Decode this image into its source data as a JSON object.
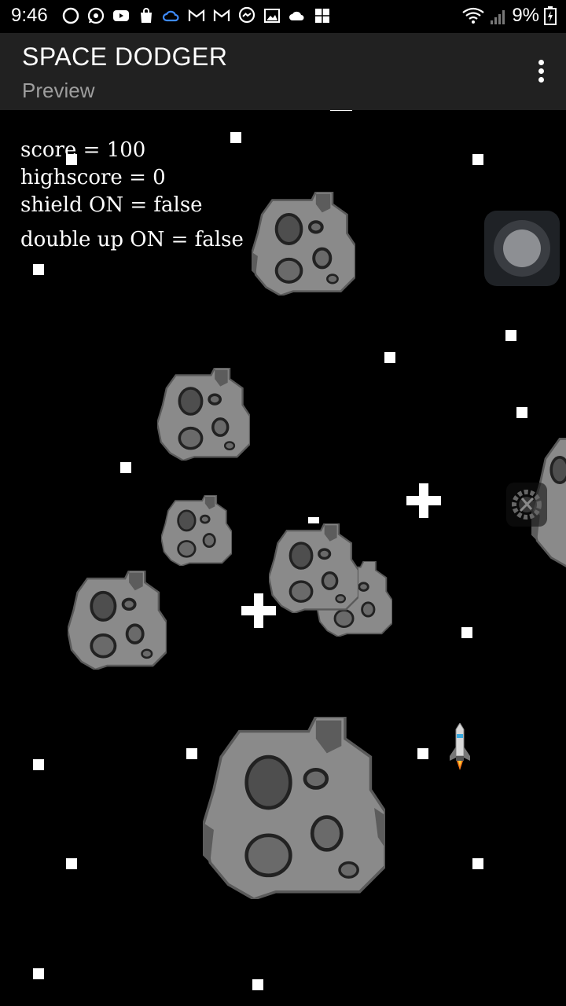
{
  "status_bar": {
    "time": "9:46",
    "battery": "9%",
    "notification_icons": [
      "circle-icon",
      "whatsapp-icon",
      "youtube-icon",
      "shopping-bag-icon",
      "cloud-icon",
      "gmail-icon",
      "gmail-icon",
      "messenger-icon",
      "gallery-icon",
      "cloud-icon",
      "puzzle-icon"
    ]
  },
  "app_bar": {
    "title": "SPACE DODGER",
    "subtitle": "Preview"
  },
  "hud": {
    "score": "score = 100",
    "highscore": "highscore = 0",
    "shield": "shield ON = false",
    "double_up": "double up ON = false"
  },
  "colors": {
    "background": "#000000",
    "app_bar": "#212121",
    "asteroid_body": "#8a8a8a",
    "asteroid_crater": "#4e4e4e"
  }
}
